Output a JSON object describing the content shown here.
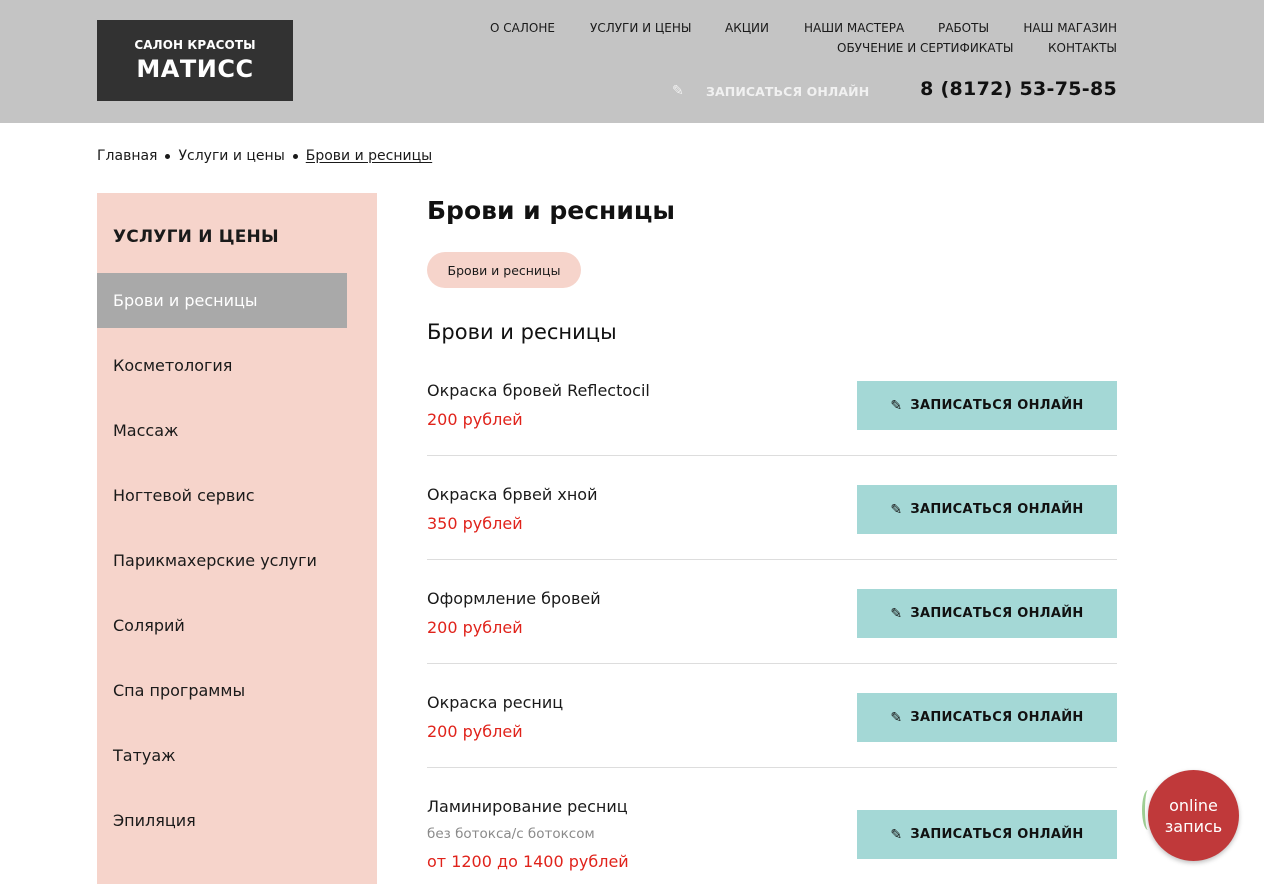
{
  "header": {
    "logo_sub": "САЛОН КРАСОТЫ",
    "logo_main": "МАТИСС",
    "nav_row1": [
      "О САЛОНЕ",
      "УСЛУГИ И ЦЕНЫ",
      "АКЦИИ",
      "НАШИ МАСТЕРА",
      "РАБОТЫ",
      "НАШ МАГАЗИН"
    ],
    "nav_row2": [
      "ОБУЧЕНИЕ И СЕРТИФИКАТЫ",
      "КОНТАКТЫ"
    ],
    "book_label": "ЗАПИСАТЬСЯ ОНЛАЙН",
    "pencil_icon": "✎",
    "phone": "8 (8172) 53-75-85"
  },
  "breadcrumbs": [
    "Главная",
    "Услуги и цены",
    "Брови и ресницы"
  ],
  "sidebar": {
    "title": "УСЛУГИ И ЦЕНЫ",
    "items": [
      "Брови и ресницы",
      "Косметология",
      "Массаж",
      "Ногтевой сервис",
      "Парикмахерские услуги",
      "Солярий",
      "Спа программы",
      "Татуаж",
      "Эпиляция"
    ]
  },
  "main": {
    "title": "Брови и ресницы",
    "chip": "Брови и ресницы",
    "section_title": "Брови и ресницы",
    "button_label": "ЗАПИСАТЬСЯ ОНЛАЙН",
    "services": [
      {
        "name": "Окраска бровей Reflectocil",
        "price": "200 рублей"
      },
      {
        "name": "Окраска брвей хной",
        "price": "350 рублей"
      },
      {
        "name": "Оформление бровей",
        "price": "200 рублей"
      },
      {
        "name": "Окраска ресниц",
        "price": "200 рублей"
      },
      {
        "name": "Ламинирование ресниц",
        "note": "без ботокса/с ботоксом",
        "price": "от 1200 до 1400 рублей"
      }
    ]
  },
  "float_widget": {
    "line1": "online",
    "line2": "запись"
  },
  "colors": {
    "header_bg": "#c4c4c4",
    "logo_bg": "#323232",
    "sidebar_bg": "#f6d4cb",
    "active_item": "#a9a9a9",
    "button_bg": "#a4d8d6",
    "price": "#e0231b",
    "widget": "#c0393a"
  }
}
